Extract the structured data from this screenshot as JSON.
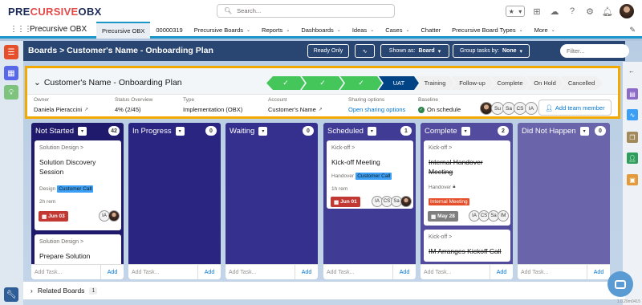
{
  "brand": {
    "logo_prefix": "PRE",
    "logo_highlight": "CURSIVE",
    "logo_suffix": "OBX"
  },
  "global": {
    "search_placeholder": "Search...",
    "version": "1.0.29m0415"
  },
  "nav": {
    "app_name": "Precursive OBX",
    "tabs": [
      {
        "label": "Precursive OBX",
        "active": true,
        "chevron": false
      },
      {
        "label": "00000319",
        "chevron": false
      },
      {
        "label": "Precursive Boards",
        "chevron": true
      },
      {
        "label": "Reports",
        "chevron": true
      },
      {
        "label": "Dashboards",
        "chevron": true
      },
      {
        "label": "Ideas",
        "chevron": true
      },
      {
        "label": "Cases",
        "chevron": true
      },
      {
        "label": "Chatter",
        "chevron": false
      },
      {
        "label": "Precursive Board Types",
        "chevron": true
      },
      {
        "label": "More",
        "chevron": true
      }
    ]
  },
  "header": {
    "breadcrumb": "Boards > Customer's Name - Onboarding Plan",
    "ready_only": "Ready Only",
    "shown_as_label": "Shown as:",
    "shown_as_value": "Board",
    "group_label": "Group tasks by:",
    "group_value": "None",
    "filter_placeholder": "Filter..."
  },
  "plan": {
    "title": "Customer's Name - Onboarding Plan",
    "path": [
      {
        "label": "✓",
        "state": "done",
        "w": 48
      },
      {
        "label": "✓",
        "state": "done",
        "w": 52
      },
      {
        "label": "✓",
        "state": "done",
        "w": 52
      },
      {
        "label": "UAT",
        "state": "current",
        "w": 50
      },
      {
        "label": "Training",
        "state": "todo",
        "w": 48
      },
      {
        "label": "Follow-up",
        "state": "todo",
        "w": 53
      },
      {
        "label": "Complete",
        "state": "todo",
        "w": 49
      },
      {
        "label": "On Hold",
        "state": "todo",
        "w": 46
      },
      {
        "label": "Cancelled",
        "state": "todo",
        "w": 53
      }
    ],
    "owner_label": "Owner",
    "owner_value": "Daniela Pieraccini",
    "status_label": "Status Overview",
    "status_value": "4% (2/45)",
    "type_label": "Type",
    "type_value": "Implementation (OBX)",
    "account_label": "Account",
    "account_value": "Customer's Name",
    "sharing_label": "Sharing options",
    "sharing_value": "Open sharing options",
    "baseline_label": "Baseline",
    "baseline_value": "On schedule",
    "team": [
      "Su",
      "Sa",
      "CS",
      "IA"
    ],
    "add_team": "Add team member"
  },
  "columns": [
    {
      "name": "Not Started",
      "count": "42",
      "color": "#1f1a6b",
      "cards": [
        {
          "crumb": "Solution Design >",
          "title": "Solution Discovery Session",
          "tag_label": "Design",
          "tag": "Customer Call",
          "rem": "2h rem",
          "due": "Jun 03",
          "due_color": "#c23934",
          "avatars": [
            "IA"
          ]
        },
        {
          "crumb": "Solution Design >",
          "title": "Prepare Solution"
        }
      ],
      "add": "Add Task...",
      "add_btn": "Add"
    },
    {
      "name": "In Progress",
      "count": "0",
      "color": "#2a2581",
      "cards": [],
      "add": "Add Task...",
      "add_btn": "Add"
    },
    {
      "name": "Waiting",
      "count": "0",
      "color": "#352f8e",
      "cards": [],
      "add": "Add Task...",
      "add_btn": "Add"
    },
    {
      "name": "Scheduled",
      "count": "1",
      "color": "#403b95",
      "cards": [
        {
          "crumb": "Kick-off >",
          "title": "Kick-off Meeting",
          "tag_label": "Handover",
          "tag": "Customer Call",
          "rem": "1h rem",
          "due": "Jun 01",
          "due_color": "#c23934",
          "avatars": [
            "IA",
            "CS",
            "Sa"
          ]
        }
      ],
      "add": "Add Task...",
      "add_btn": "Add"
    },
    {
      "name": "Complete",
      "count": "2",
      "color": "#524b9e",
      "cards": [
        {
          "crumb": "Kick-off >",
          "title": "Internal Handover Meeting",
          "tag_label": "Handover",
          "tag": "Internal Meeting",
          "due": "May 28",
          "due_color": "#7f7f7f",
          "avatars": [
            "IA",
            "CS",
            "Sa",
            "IM"
          ]
        },
        {
          "crumb": "Kick-off >",
          "title": "IM Arranges Kickoff Call"
        }
      ],
      "add": "Add Task...",
      "add_btn": "Add"
    },
    {
      "name": "Did Not Happen",
      "count": "0",
      "color": "#6a65aa",
      "cards": [],
      "add": "Add Task...",
      "add_btn": "Add"
    }
  ],
  "related": {
    "label": "Related Boards",
    "count": "1"
  }
}
